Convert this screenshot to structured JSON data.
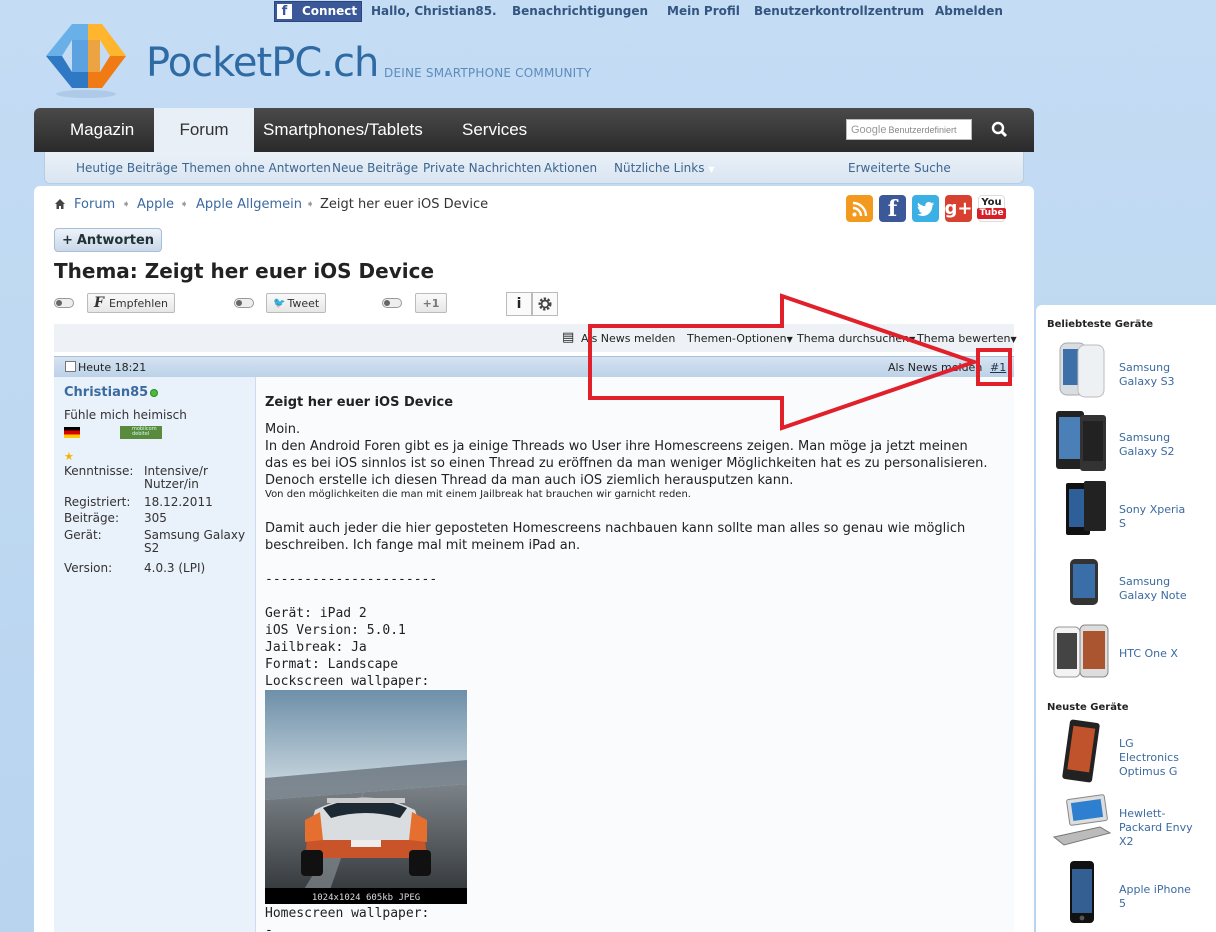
{
  "topbar": {
    "connect_label": "Connect",
    "greeting": "Hallo, Christian85.",
    "links": [
      "Benachrichtigungen",
      "Mein Profil",
      "Benutzerkontrollzentrum",
      "Abmelden"
    ]
  },
  "logo": {
    "name_main": "PocketPC",
    "name_suffix": ".ch",
    "tagline": "DEINE SMARTPHONE COMMUNITY"
  },
  "nav": {
    "tabs": [
      "Magazin",
      "Forum",
      "Smartphones/Tablets",
      "Services"
    ],
    "active": "Forum",
    "search_brand": "Google",
    "search_placeholder": "Benutzerdefiniert"
  },
  "subnav": {
    "links": [
      "Heutige Beiträge",
      "Themen ohne Antworten",
      "Neue Beiträge",
      "Private Nachrichten",
      "Aktionen",
      "Nützliche Links"
    ],
    "advanced_search": "Erweiterte Suche"
  },
  "breadcrumb": [
    "Forum",
    "Apple",
    "Apple Allgemein",
    "Zeigt her euer iOS Device"
  ],
  "social_icons": [
    "rss-icon",
    "facebook-icon",
    "twitter-icon",
    "google-plus-icon",
    "youtube-icon"
  ],
  "social_labels": {
    "google_plus": "g+",
    "youtube_top": "You",
    "youtube_bottom": "Tube"
  },
  "thread": {
    "reply_label": "Antworten",
    "title": "Thema: Zeigt her euer iOS Device",
    "share": {
      "facebook": "Empfehlen",
      "twitter": "Tweet",
      "gplus": "+1"
    },
    "info_label": "i",
    "tools": [
      "Als News melden",
      "Themen-Optionen",
      "Thema durchsuchen",
      "Thema bewerten"
    ]
  },
  "post": {
    "date": "Heute 18:21",
    "report": "Als News melden",
    "number": "#1",
    "user": {
      "name": "Christian85",
      "rank": "Fühle mich heimisch",
      "provider_badge": "mobilcom debitel",
      "fields": [
        {
          "label": "Kenntnisse:",
          "value_1": "Intensive/r",
          "value_2": "Nutzer/in"
        },
        {
          "label": "Registriert:",
          "value_1": "18.12.2011"
        },
        {
          "label": "Beiträge:",
          "value_1": "305"
        },
        {
          "label": "Gerät:",
          "value_1": "Samsung Galaxy",
          "value_2": "S2"
        },
        {
          "label": "Version:",
          "value_1": "4.0.3 (LPI)"
        }
      ]
    },
    "title": "Zeigt her euer iOS Device",
    "lines": [
      "Moin.",
      "In den Android Foren gibt es ja einige Threads wo User ihre Homescreens zeigen. Man möge ja jetzt meinen",
      "das es bei iOS sinnlos ist so einen Thread zu eröffnen da man weniger Möglichkeiten hat es zu personalisieren.",
      "Denoch erstelle ich diesen Thread da man auch iOS ziemlich herausputzen kann."
    ],
    "small_line": "Von den möglichkeiten die man mit einem Jailbreak hat brauchen wir garnicht reden.",
    "lines2": [
      "Damit auch jeder die hier geposteten Homescreens nachbauen kann sollte man alles so genau wie möglich",
      "beschreiben. Ich fange mal mit meinem iPad an."
    ],
    "separator": "----------------------",
    "specs": [
      "Gerät: iPad 2",
      "iOS Version: 5.0.1",
      "Jailbreak: Ja",
      "Format: Landscape",
      "Lockscreen wallpaper:"
    ],
    "image_caption": "1024x1024 605kb JPEG",
    "homescreen_label": "Homescreen wallpaper:",
    "trailing": "-"
  },
  "sidebar": {
    "popular_title": "Beliebteste Geräte",
    "popular": [
      {
        "line1": "Samsung",
        "line2": "Galaxy S3"
      },
      {
        "line1": "Samsung",
        "line2": "Galaxy S2"
      },
      {
        "line1": "Sony Xperia",
        "line2": "S"
      },
      {
        "line1": "Samsung",
        "line2": "Galaxy Note"
      },
      {
        "line1": "HTC One X",
        "line2": ""
      }
    ],
    "newest_title": "Neuste Geräte",
    "newest": [
      {
        "line1": "LG",
        "line2": "Electronics",
        "line3": "Optimus G"
      },
      {
        "line1": "Hewlett-",
        "line2": "Packard Envy",
        "line3": "X2"
      },
      {
        "line1": "Apple iPhone",
        "line2": "5",
        "line3": ""
      }
    ]
  },
  "colors": {
    "link": "#3b6aa0",
    "annotation": "#e0202a",
    "nav_bg": "#333333",
    "fb": "#3b5998"
  }
}
